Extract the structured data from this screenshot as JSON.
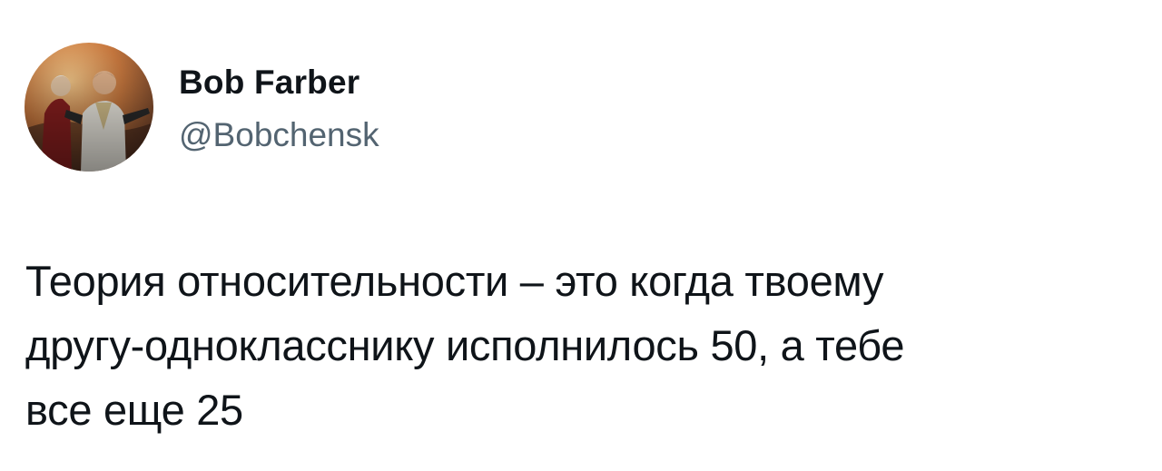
{
  "author": {
    "display_name": "Bob Farber",
    "handle": "@Bobchensk",
    "avatar_icon": "profile-photo"
  },
  "tweet": {
    "text": "Теория относительности – это когда твоему\nдругу-однокласснику исполнилось 50, а тебе\nвсе еще 25"
  },
  "colors": {
    "text": "#0f1419",
    "handle": "#536471",
    "background": "#ffffff"
  }
}
